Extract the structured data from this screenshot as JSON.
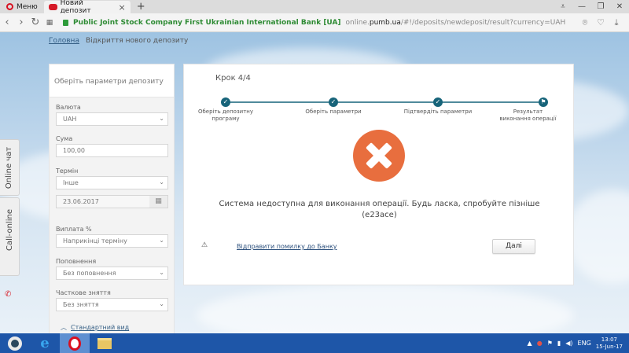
{
  "browser": {
    "menu_label": "Меню",
    "tab_title": "Новий депозит",
    "new_tab": "+",
    "url_cert": "Public Joint Stock Company First Ukrainian International Bank [UA]",
    "url_prefix": "online.",
    "url_domain": "pumb.ua",
    "url_path": "/#!/deposits/newdeposit/result?currency=UAH"
  },
  "breadcrumb": {
    "home": "Головна",
    "current": "Відкриття нового депозиту"
  },
  "side_tabs": {
    "online_chat": "Online чат",
    "call_online": "Call-online"
  },
  "params": {
    "title": "Оберіть параметри депозиту",
    "currency_label": "Валюта",
    "currency_value": "UAH",
    "amount_label": "Сума",
    "amount_value": "100,00",
    "term_label": "Термін",
    "term_value": "Інше",
    "date_value": "23.06.2017",
    "payout_label": "Виплата %",
    "payout_value": "Наприкінці терміну",
    "topup_label": "Поповнення",
    "topup_value": "Без поповнення",
    "withdraw_label": "Часткове зняття",
    "withdraw_value": "Без зняття",
    "standard_view": "Стандартний вид"
  },
  "wizard": {
    "step": "Крок 4/4",
    "steps": [
      "Оберіть депозитну програму",
      "Оберіть параметри",
      "Підтвердіть параметри",
      "Результат виконання операції"
    ],
    "progress_fraction": 1.0
  },
  "result": {
    "message": "Система недоступна для виконання операції. Будь ласка, спробуйте пізніше",
    "code": "(e23ace)",
    "report_link": "Відправити помилку до Банку",
    "next_button": "Далі",
    "error_color": "#e86e3e"
  },
  "taskbar": {
    "lang": "ENG",
    "time": "13:07",
    "date": "15-Jun-17"
  }
}
